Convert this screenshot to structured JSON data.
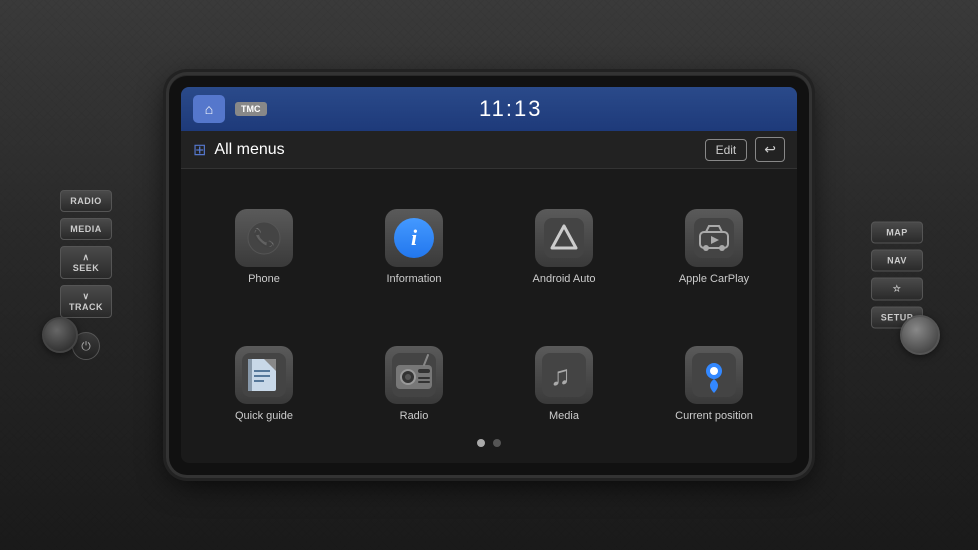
{
  "dashboard": {
    "background": "carbon fiber dark"
  },
  "left_buttons": {
    "radio": "RADIO",
    "media": "MEDIA",
    "seek_up": "∧ SEEK",
    "seek_down": "∨ TRACK"
  },
  "right_buttons": {
    "map": "MAP",
    "nav": "NAV",
    "star": "☆",
    "setup": "SETUP"
  },
  "top_bar": {
    "home_label": "⌂",
    "tmc_label": "TMC",
    "clock": "11:13"
  },
  "menu_bar": {
    "title": "All menus",
    "edit_label": "Edit",
    "back_label": "↩"
  },
  "apps": [
    {
      "id": "phone",
      "label": "Phone",
      "icon_type": "phone"
    },
    {
      "id": "information",
      "label": "Information",
      "icon_type": "info"
    },
    {
      "id": "android_auto",
      "label": "Android Auto",
      "icon_type": "android"
    },
    {
      "id": "apple_carplay",
      "label": "Apple CarPlay",
      "icon_type": "carplay"
    },
    {
      "id": "quick_guide",
      "label": "Quick guide",
      "icon_type": "guide"
    },
    {
      "id": "radio",
      "label": "Radio",
      "icon_type": "radio"
    },
    {
      "id": "media",
      "label": "Media",
      "icon_type": "media"
    },
    {
      "id": "current_position",
      "label": "Current position",
      "icon_type": "position"
    }
  ],
  "page_dots": [
    {
      "active": true
    },
    {
      "active": false
    }
  ]
}
